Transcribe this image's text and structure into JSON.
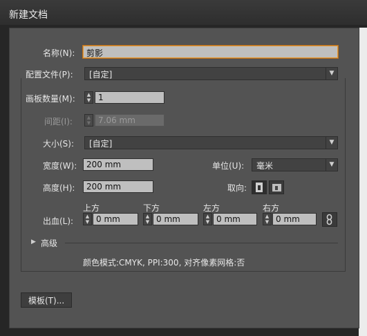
{
  "window": {
    "title": "新建文档"
  },
  "name": {
    "label": "名称(N):",
    "value": "剪影"
  },
  "profile": {
    "label": "配置文件(P):",
    "value": "[自定]"
  },
  "artboards": {
    "count_label": "画板数量(M):",
    "count_value": "1",
    "spacing_label": "间距(I):",
    "spacing_value": "7.06 mm"
  },
  "size": {
    "label": "大小(S):",
    "value": "[自定]"
  },
  "width": {
    "label": "宽度(W):",
    "value": "200 mm"
  },
  "height": {
    "label": "高度(H):",
    "value": "200 mm"
  },
  "units": {
    "label": "单位(U):",
    "value": "毫米"
  },
  "orientation": {
    "label": "取向:",
    "portrait_icon": "portrait-orientation-icon",
    "landscape_icon": "landscape-orientation-icon"
  },
  "bleed": {
    "label": "出血(L):",
    "top_label": "上方",
    "top_value": "0 mm",
    "bottom_label": "下方",
    "bottom_value": "0 mm",
    "left_label": "左方",
    "left_value": "0 mm",
    "right_label": "右方",
    "right_value": "0 mm",
    "link_icon": "chain-link-icon"
  },
  "advanced": {
    "label": "高级"
  },
  "summary": {
    "text": "颜色模式:CMYK, PPI:300, 对齐像素网格:否"
  },
  "template_button": {
    "label": "模板(T)..."
  },
  "colors": {
    "focus_border": "#e09a3a",
    "panel": "#535353",
    "field": "#bfbfbf"
  }
}
